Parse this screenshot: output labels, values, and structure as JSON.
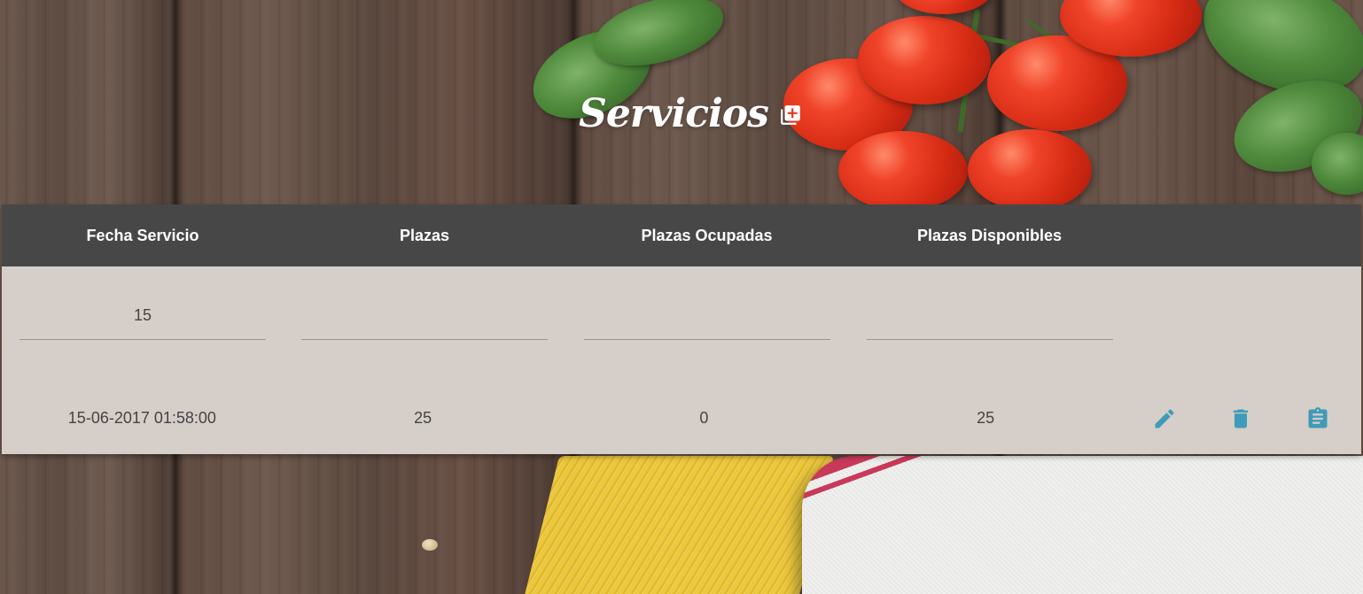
{
  "header": {
    "title": "Servicios",
    "add_icon": "add-box-icon"
  },
  "table": {
    "columns": [
      "Fecha Servicio",
      "Plazas",
      "Plazas Ocupadas",
      "Plazas Disponibles"
    ],
    "filters": {
      "fecha_servicio": "15",
      "plazas": "",
      "plazas_ocupadas": "",
      "plazas_disponibles": ""
    },
    "rows": [
      {
        "fecha_servicio": "15-06-2017 01:58:00",
        "plazas": "25",
        "plazas_ocupadas": "0",
        "plazas_disponibles": "25"
      }
    ],
    "action_icons": [
      "pencil-icon",
      "trash-icon",
      "clipboard-icon"
    ]
  },
  "colors": {
    "header_bg": "#474747",
    "table_bg": "#d6cec8",
    "action_accent": "#3f9bb8",
    "title_color": "#ffffff"
  }
}
